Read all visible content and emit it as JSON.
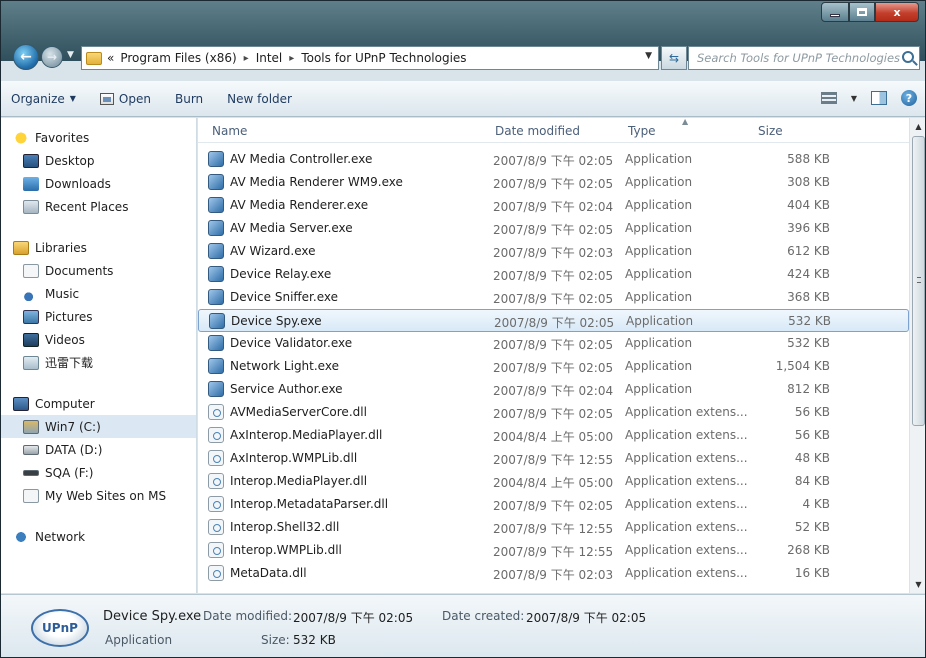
{
  "titlebar": {
    "minimize": "",
    "maximize": "",
    "close": "x"
  },
  "address": {
    "crumbs_prefix": "«",
    "crumbs": [
      "Program Files (x86)",
      "Intel",
      "Tools for UPnP Technologies"
    ],
    "separator": "▸"
  },
  "search": {
    "placeholder": "Search Tools for UPnP Technologies"
  },
  "commands": {
    "organize": "Organize",
    "open": "Open",
    "burn": "Burn",
    "new_folder": "New folder",
    "help": "?"
  },
  "nav": {
    "favorites": {
      "label": "Favorites",
      "items": [
        "Desktop",
        "Downloads",
        "Recent Places"
      ]
    },
    "libraries": {
      "label": "Libraries",
      "items": [
        "Documents",
        "Music",
        "Pictures",
        "Videos",
        "迅雷下载"
      ]
    },
    "computer": {
      "label": "Computer",
      "items": [
        "Win7 (C:)",
        "DATA (D:)",
        "SQA (F:)",
        "My Web Sites on MS"
      ]
    },
    "network": {
      "label": "Network"
    }
  },
  "columns": {
    "name": "Name",
    "date": "Date modified",
    "type": "Type",
    "size": "Size"
  },
  "files": [
    {
      "name": "AV Media Controller.exe",
      "date": "2007/8/9 下午 02:05",
      "type": "Application",
      "size": "588 KB",
      "kind": "app"
    },
    {
      "name": "AV Media Renderer WM9.exe",
      "date": "2007/8/9 下午 02:05",
      "type": "Application",
      "size": "308 KB",
      "kind": "app"
    },
    {
      "name": "AV Media Renderer.exe",
      "date": "2007/8/9 下午 02:04",
      "type": "Application",
      "size": "404 KB",
      "kind": "app"
    },
    {
      "name": "AV Media Server.exe",
      "date": "2007/8/9 下午 02:05",
      "type": "Application",
      "size": "396 KB",
      "kind": "app"
    },
    {
      "name": "AV Wizard.exe",
      "date": "2007/8/9 下午 02:03",
      "type": "Application",
      "size": "612 KB",
      "kind": "app"
    },
    {
      "name": "Device Relay.exe",
      "date": "2007/8/9 下午 02:05",
      "type": "Application",
      "size": "424 KB",
      "kind": "app"
    },
    {
      "name": "Device Sniffer.exe",
      "date": "2007/8/9 下午 02:05",
      "type": "Application",
      "size": "368 KB",
      "kind": "app"
    },
    {
      "name": "Device Spy.exe",
      "date": "2007/8/9 下午 02:05",
      "type": "Application",
      "size": "532 KB",
      "kind": "app",
      "selected": true
    },
    {
      "name": "Device Validator.exe",
      "date": "2007/8/9 下午 02:05",
      "type": "Application",
      "size": "532 KB",
      "kind": "app"
    },
    {
      "name": "Network Light.exe",
      "date": "2007/8/9 下午 02:05",
      "type": "Application",
      "size": "1,504 KB",
      "kind": "app"
    },
    {
      "name": "Service Author.exe",
      "date": "2007/8/9 下午 02:04",
      "type": "Application",
      "size": "812 KB",
      "kind": "app"
    },
    {
      "name": "AVMediaServerCore.dll",
      "date": "2007/8/9 下午 02:05",
      "type": "Application extens...",
      "size": "56 KB",
      "kind": "dll"
    },
    {
      "name": "AxInterop.MediaPlayer.dll",
      "date": "2004/8/4 上午 05:00",
      "type": "Application extens...",
      "size": "56 KB",
      "kind": "dll"
    },
    {
      "name": "AxInterop.WMPLib.dll",
      "date": "2007/8/9 下午 12:55",
      "type": "Application extens...",
      "size": "48 KB",
      "kind": "dll"
    },
    {
      "name": "Interop.MediaPlayer.dll",
      "date": "2004/8/4 上午 05:00",
      "type": "Application extens...",
      "size": "84 KB",
      "kind": "dll"
    },
    {
      "name": "Interop.MetadataParser.dll",
      "date": "2007/8/9 下午 02:05",
      "type": "Application extens...",
      "size": "4 KB",
      "kind": "dll"
    },
    {
      "name": "Interop.Shell32.dll",
      "date": "2007/8/9 下午 12:55",
      "type": "Application extens...",
      "size": "52 KB",
      "kind": "dll"
    },
    {
      "name": "Interop.WMPLib.dll",
      "date": "2007/8/9 下午 12:55",
      "type": "Application extens...",
      "size": "268 KB",
      "kind": "dll"
    },
    {
      "name": "MetaData.dll",
      "date": "2007/8/9 下午 02:03",
      "type": "Application extens...",
      "size": "16 KB",
      "kind": "dll"
    }
  ],
  "details": {
    "icon_text": "UPnP",
    "name": "Device Spy.exe",
    "type": "Application",
    "modified_label": "Date modified:",
    "modified": "2007/8/9 下午 02:05",
    "created_label": "Date created:",
    "created": "2007/8/9 下午 02:05",
    "size_label": "Size:",
    "size": "532 KB"
  },
  "colors": {
    "selection": "#d8e9f7",
    "selection_border": "#7da2ce",
    "link": "#1e3a5f"
  }
}
